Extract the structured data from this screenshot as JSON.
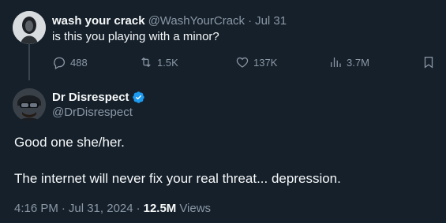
{
  "parent_tweet": {
    "author_name": "wash your crack",
    "author_handle": "@WashYourCrack",
    "separator": "·",
    "date": "Jul 31",
    "text": "is this you playing with a minor?",
    "actions": {
      "replies": "488",
      "reposts": "1.5K",
      "likes": "137K",
      "views": "3.7M"
    },
    "icons": [
      "reply-icon",
      "repost-icon",
      "like-icon",
      "views-icon",
      "bookmark-icon"
    ]
  },
  "main_tweet": {
    "author_name": "Dr Disrespect",
    "author_handle": "@DrDisrespect",
    "verified_color": "#1d9bf0",
    "body_lines": [
      "Good one she/her.",
      "The internet will never fix your real threat... depression."
    ],
    "time": "4:16 PM",
    "separator": "·",
    "date": "Jul 31, 2024",
    "separator2": "·",
    "views_count": "12.5M",
    "views_label": "Views"
  },
  "colors": {
    "background": "#15202b",
    "text": "#f7f9f9",
    "muted": "#8b98a5",
    "thread_line": "#38444d"
  }
}
